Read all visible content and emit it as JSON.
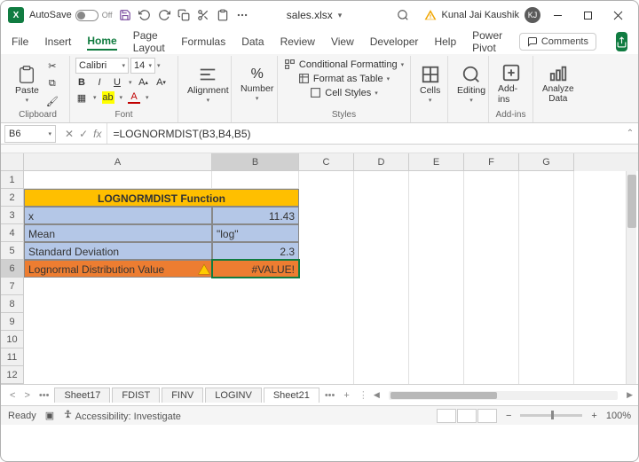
{
  "titlebar": {
    "autosave_label": "AutoSave",
    "autosave_state": "Off",
    "filename": "sales.xlsx",
    "user_name": "Kunal Jai Kaushik",
    "user_initials": "KJ"
  },
  "menu": {
    "file": "File",
    "insert": "Insert",
    "home": "Home",
    "page_layout": "Page Layout",
    "formulas": "Formulas",
    "data": "Data",
    "review": "Review",
    "view": "View",
    "developer": "Developer",
    "help": "Help",
    "power_pivot": "Power Pivot",
    "comments": "Comments"
  },
  "ribbon": {
    "paste": "Paste",
    "clipboard": "Clipboard",
    "font_name": "Calibri",
    "font_size": "14",
    "font": "Font",
    "alignment": "Alignment",
    "number": "Number",
    "cond_fmt": "Conditional Formatting",
    "fmt_table": "Format as Table",
    "cell_styles": "Cell Styles",
    "styles": "Styles",
    "cells": "Cells",
    "editing": "Editing",
    "addins": "Add-ins",
    "analyze": "Analyze Data"
  },
  "formula_bar": {
    "name_box": "B6",
    "formula": "=LOGNORMDIST(B3,B4,B5)"
  },
  "columns": [
    "A",
    "B",
    "C",
    "D",
    "E",
    "F",
    "G"
  ],
  "rows": [
    "1",
    "2",
    "3",
    "4",
    "5",
    "6",
    "7",
    "8",
    "9",
    "10",
    "11",
    "12"
  ],
  "cells": {
    "title": "LOGNORMDIST Function",
    "a3": "x",
    "b3": "11.43",
    "a4": "Mean",
    "b4": "\"log\"",
    "a5": "Standard Deviation",
    "b5": "2.3",
    "a6": "Lognormal Distribution Value",
    "b6": "#VALUE!"
  },
  "sheets": {
    "s1": "Sheet17",
    "s2": "FDIST",
    "s3": "FINV",
    "s4": "LOGINV",
    "s5": "Sheet21"
  },
  "status": {
    "ready": "Ready",
    "accessibility": "Accessibility: Investigate",
    "zoom": "100%"
  }
}
